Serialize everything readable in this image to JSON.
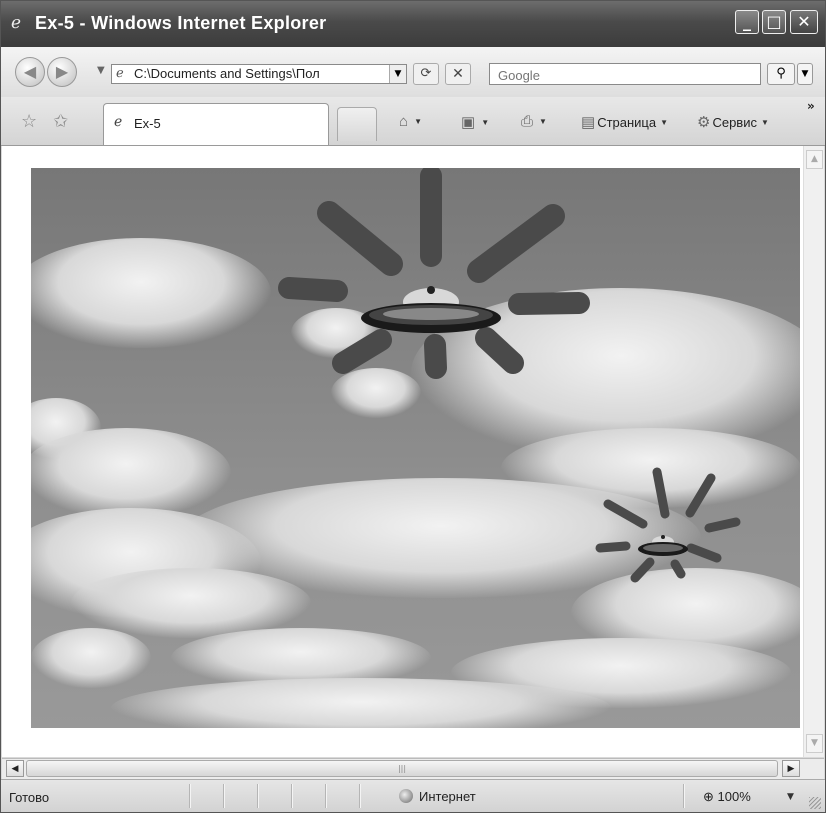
{
  "window": {
    "title": "Ex-5 - Windows Internet Explorer",
    "controls": {
      "minimize": "_",
      "maximize": "□",
      "close": "✕"
    }
  },
  "address_bar": {
    "url": "C:\\Documents and Settings\\Пол",
    "search_placeholder": "Google"
  },
  "tabs": [
    {
      "label": "Ex-5"
    }
  ],
  "command_bar": {
    "page_label": "Страница",
    "tools_label": "Сервис"
  },
  "statusbar": {
    "status": "Готово",
    "zone": "Интернет",
    "zoom": "100%"
  },
  "icons": [
    "back-arrow-icon",
    "forward-arrow-icon",
    "refresh-icon",
    "stop-icon",
    "search-icon",
    "favorites-star-icon",
    "add-favorites-icon",
    "home-icon",
    "feeds-icon",
    "print-icon",
    "page-icon",
    "tools-gear-icon",
    "globe-icon",
    "magnifier-icon"
  ],
  "colors": {
    "titlebar": "#4a4a4a",
    "sky": "#8e8e8e",
    "ufo_rays": "#4a4a4a"
  }
}
